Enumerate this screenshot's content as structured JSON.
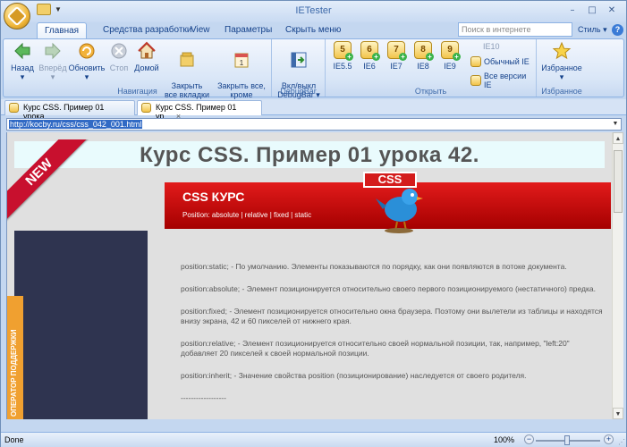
{
  "app": {
    "title": "IETester",
    "window_controls": [
      "–",
      "□",
      "✕"
    ]
  },
  "tabs": [
    {
      "label": "Главная",
      "active": true
    },
    {
      "label": "Средства разработки"
    },
    {
      "label": "View"
    },
    {
      "label": "Параметры"
    },
    {
      "label": "Скрыть меню"
    }
  ],
  "search": {
    "placeholder": "Поиск в интернете"
  },
  "style_label": "Стиль",
  "help_label": "?",
  "ribbon": {
    "navigation": {
      "label": "Навигация",
      "back": "Назад",
      "forward": "Вперёд",
      "refresh": "Обновить",
      "stop": "Стоп",
      "home": "Домой",
      "close_all": "Закрыть\nвсе вкладки",
      "close_all_but": "Закрыть все,\nкроме активной"
    },
    "debugbar": {
      "label": "DebugBar",
      "toggle": "Вкл/выкл\nDebugBar"
    },
    "open": {
      "label": "Открыть",
      "versions": [
        {
          "label": "IE5.5",
          "num": "5"
        },
        {
          "label": "IE6",
          "num": "6"
        },
        {
          "label": "IE7",
          "num": "7"
        },
        {
          "label": "IE8",
          "num": "8"
        },
        {
          "label": "IE9",
          "num": "9"
        }
      ],
      "ie10": "IE10",
      "normal": "Обычный IE",
      "all": "Все версии IE"
    },
    "favorites": {
      "label": "Избранное",
      "button": "Избранное"
    }
  },
  "doc_tabs": [
    {
      "label": "Курс CSS. Пример 01 урока...",
      "active": false
    },
    {
      "label": "Курс CSS. Пример 01 ур...",
      "active": true,
      "close": "×"
    }
  ],
  "address": "http://kocby.ru/css/css_042_001.html",
  "page": {
    "title": "Курс CSS. Пример 01 урока 42.",
    "new_badge": "NEW",
    "banner_title": "CSS КУРС",
    "banner_sub": "Position: absolute | relative | fixed | static",
    "css_badge": "CSS",
    "operator": "ОПЕРАТОР ПОДДЕРЖКИ",
    "paragraphs": [
      "position:static; - По умолчанию. Элементы показываются по порядку, как они появляются в потоке документа.",
      "position:absolute; - Элемент позиционируется относительно своего первого позиционируемого (нестатичного) предка.",
      "position:fixed; - Элемент позиционируется относительно окна браузера. Поэтому они вылетели из таблицы и находятся внизу экрана, 42 и 60 пикселей от нижнего края.",
      "position:relative; - Элемент позиционируется относительно своей нормальной позиции, так, например, \"left:20\" добавляет 20 пикселей к своей нормальной позиции.",
      "position:inherit; - Значение свойства position (позиционирование) наследуется от своего родителя.",
      "------------------"
    ]
  },
  "status": {
    "text": "Done",
    "zoom": "100%",
    "zoom_out": "−",
    "zoom_in": "+"
  }
}
